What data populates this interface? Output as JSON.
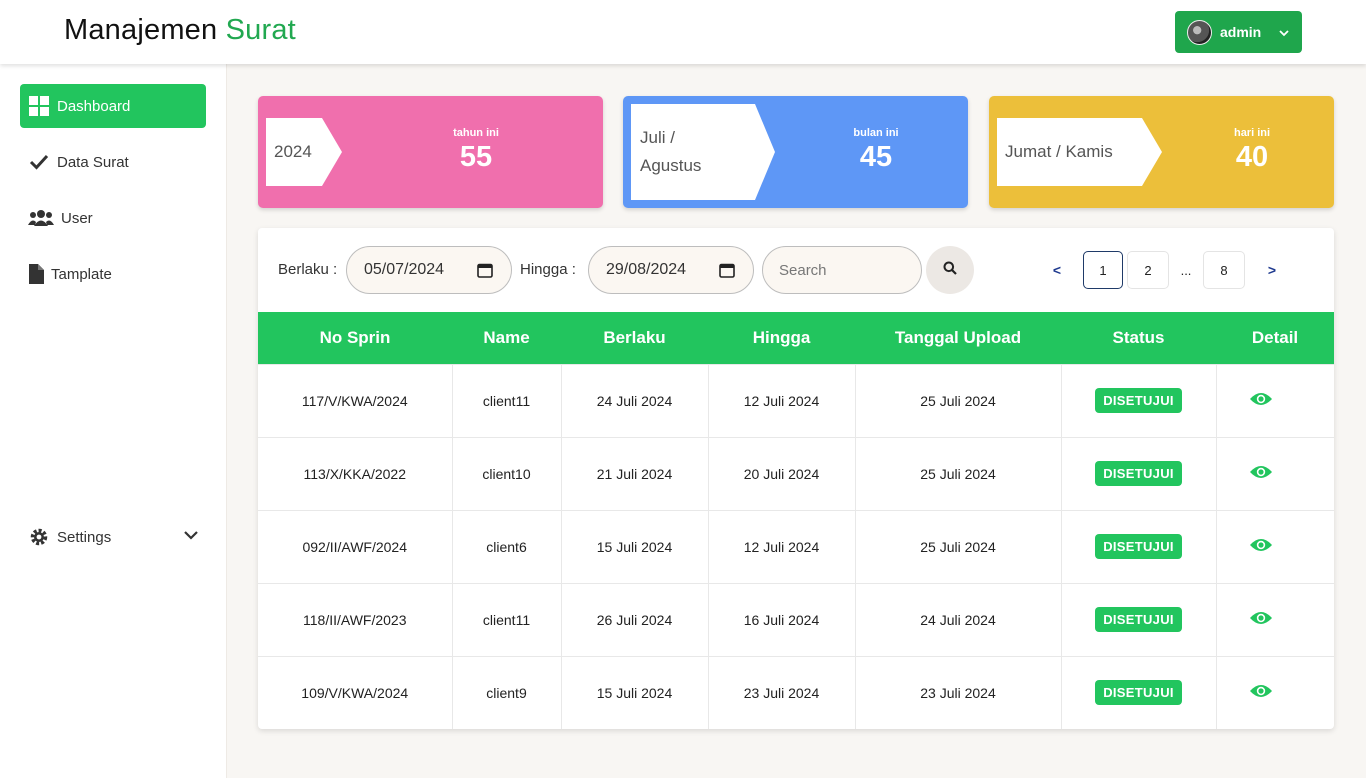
{
  "header": {
    "brand_main": "Manajemen",
    "brand_accent": "Surat",
    "user_label": "admin"
  },
  "sidebar": {
    "items": [
      {
        "label": "Dashboard",
        "icon": "grid-icon",
        "active": true
      },
      {
        "label": "Data Surat",
        "icon": "check-icon"
      },
      {
        "label": "User",
        "icon": "users-icon"
      },
      {
        "label": "Tamplate",
        "icon": "file-icon"
      }
    ],
    "settings_label": "Settings"
  },
  "stats": [
    {
      "tag": "2024",
      "caption": "tahun ini",
      "value": "55",
      "color": "#f06fad"
    },
    {
      "tag_line1": "Juli /",
      "tag_line2": "Agustus",
      "caption": "bulan ini",
      "value": "45",
      "color": "#5e97f6"
    },
    {
      "tag": "Jumat / Kamis",
      "caption": "hari ini",
      "value": "40",
      "color": "#ecbf3a"
    }
  ],
  "filters": {
    "berlaku_label": "Berlaku :",
    "berlaku_value": "05/07/2024",
    "hingga_label": "Hingga :",
    "hingga_value": "29/08/2024",
    "search_placeholder": "Search"
  },
  "pagination": {
    "prev": "<",
    "pages": [
      "1",
      "2"
    ],
    "ellipsis": "...",
    "last": "8",
    "next": ">",
    "current": "1"
  },
  "table": {
    "columns": [
      "No Sprin",
      "Name",
      "Berlaku",
      "Hingga",
      "Tanggal Upload",
      "Status",
      "Detail"
    ],
    "rows": [
      {
        "no": "117/V/KWA/2024",
        "name": "client11",
        "berlaku": "24 Juli 2024",
        "hingga": "12 Juli 2024",
        "upload": "25 Juli 2024",
        "status": "DISETUJUI"
      },
      {
        "no": "113/X/KKA/2022",
        "name": "client10",
        "berlaku": "21 Juli 2024",
        "hingga": "20 Juli 2024",
        "upload": "25 Juli 2024",
        "status": "DISETUJUI"
      },
      {
        "no": "092/II/AWF/2024",
        "name": "client6",
        "berlaku": "15 Juli 2024",
        "hingga": "12 Juli 2024",
        "upload": "25 Juli 2024",
        "status": "DISETUJUI"
      },
      {
        "no": "118/II/AWF/2023",
        "name": "client11",
        "berlaku": "26 Juli 2024",
        "hingga": "16 Juli 2024",
        "upload": "24 Juli 2024",
        "status": "DISETUJUI"
      },
      {
        "no": "109/V/KWA/2024",
        "name": "client9",
        "berlaku": "15 Juli 2024",
        "hingga": "23 Juli 2024",
        "upload": "23 Juli 2024",
        "status": "DISETUJUI"
      }
    ]
  },
  "colors": {
    "accent": "#22c55e",
    "pink": "#f06fad",
    "blue": "#5e97f6",
    "yellow": "#ecbf3a"
  }
}
